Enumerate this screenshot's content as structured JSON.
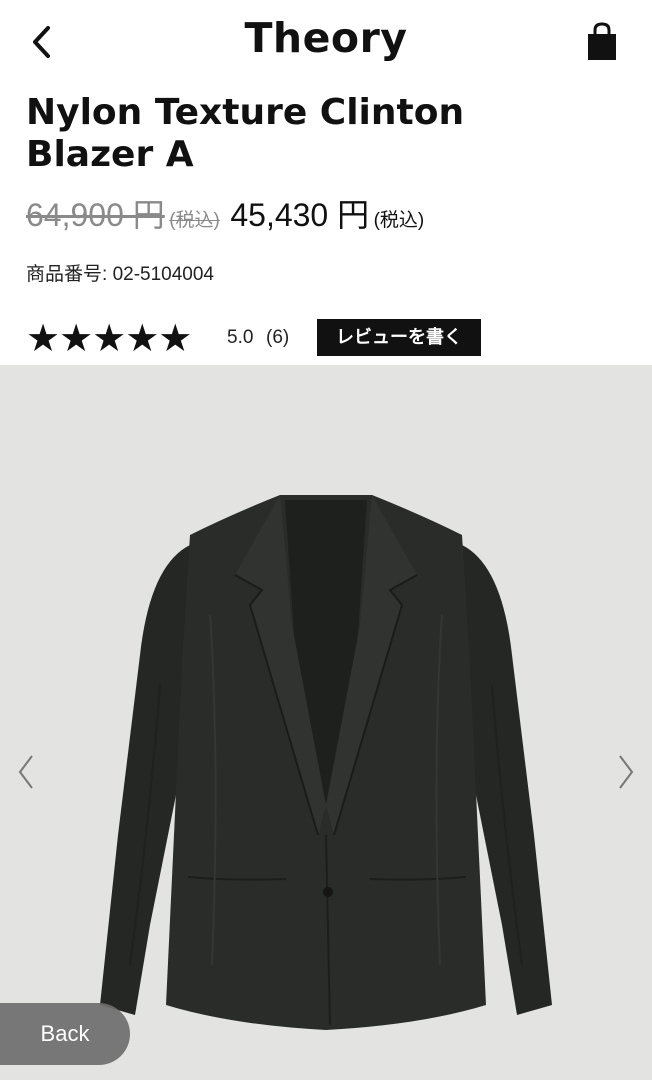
{
  "header": {
    "brand": "Theory",
    "back_icon": "chevron-left-icon",
    "bag_icon": "shopping-bag-icon"
  },
  "product": {
    "title_line1": "Nylon Texture Clinton",
    "title_line2": "Blazer A",
    "old_price": "64,900 円",
    "old_price_tax": "(税込)",
    "new_price": "45,430 円",
    "new_price_tax": "(税込)",
    "sku_label": "商品番号: ",
    "sku": "02-5104004"
  },
  "rating": {
    "stars_display": "★★★★★",
    "stars_value": 5,
    "stars_max": 5,
    "value": "5.0",
    "count": "(6)",
    "write_review_label": "レビューを書く"
  },
  "gallery": {
    "background_color": "#e3e4e1",
    "prev_icon": "chevron-left-icon",
    "next_icon": "chevron-right-icon"
  },
  "overlay": {
    "back_label": "Back"
  },
  "colors": {
    "text": "#111111",
    "strike": "#8a8a8a",
    "review_button_bg": "#111111",
    "jacket": "#2a2c29"
  }
}
